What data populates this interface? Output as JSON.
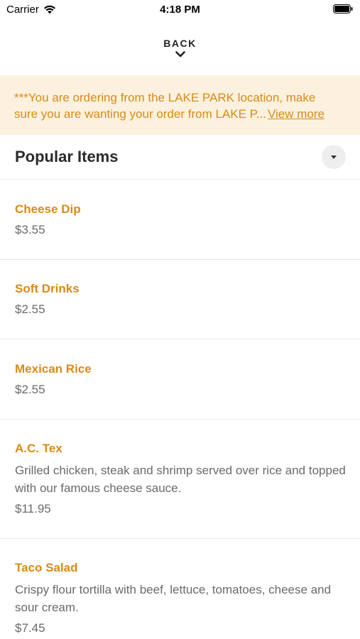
{
  "status_bar": {
    "carrier": "Carrier",
    "time": "4:18 PM"
  },
  "back": {
    "label": "BACK"
  },
  "notice": {
    "line1": "***You are ordering from the LAKE PARK location, make",
    "line2": "sure you are wanting your order from LAKE P...",
    "view_more": "View more"
  },
  "section": {
    "title": "Popular Items"
  },
  "items": [
    {
      "name": "Cheese Dip",
      "description": "",
      "price": "$3.55"
    },
    {
      "name": "Soft Drinks",
      "description": "",
      "price": "$2.55"
    },
    {
      "name": "Mexican Rice",
      "description": "",
      "price": "$2.55"
    },
    {
      "name": "A.C. Tex",
      "description": "Grilled chicken, steak and shrimp served over rice and topped with our famous cheese sauce.",
      "price": "$11.95"
    },
    {
      "name": "Taco Salad",
      "description": "Crispy flour tortilla with beef, lettuce, tomatoes, cheese and sour cream.",
      "price": "$7.45"
    }
  ],
  "colors": {
    "accent": "#d98a16",
    "notice_bg": "#fcf1df",
    "muted_text": "#6a6a6a"
  }
}
